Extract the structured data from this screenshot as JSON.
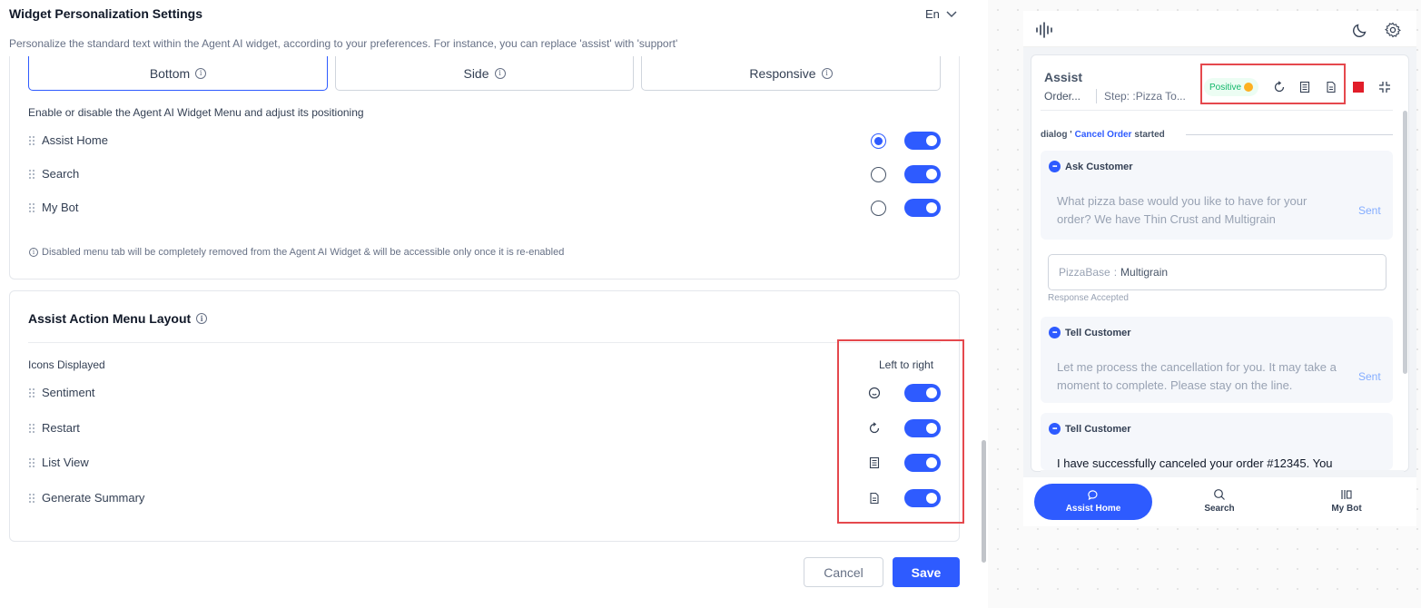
{
  "settings": {
    "title": "Widget Personalization Settings",
    "language": "En",
    "subtitle": "Personalize the standard text within the Agent AI widget, according to your preferences. For instance, you can replace 'assist' with 'support'",
    "position_tabs": [
      "Bottom",
      "Side",
      "Responsive"
    ],
    "active_position_tab": "Bottom",
    "menu_section_label": "Enable or disable the Agent AI Widget Menu and adjust its positioning",
    "menu_items": [
      {
        "label": "Assist Home",
        "default": true,
        "enabled": true
      },
      {
        "label": "Search",
        "default": false,
        "enabled": true
      },
      {
        "label": "My Bot",
        "default": false,
        "enabled": true
      }
    ],
    "menu_note": "Disabled menu tab will be completely removed from the Agent AI Widget & will be accessible only once it is re-enabled",
    "action_menu": {
      "title": "Assist Action Menu Layout",
      "icons_label": "Icons Displayed",
      "direction_label": "Left to right",
      "items": [
        {
          "label": "Sentiment",
          "icon": "smiley-icon",
          "enabled": true
        },
        {
          "label": "Restart",
          "icon": "restart-icon",
          "enabled": true
        },
        {
          "label": "List View",
          "icon": "list-view-icon",
          "enabled": true
        },
        {
          "label": "Generate Summary",
          "icon": "summary-doc-icon",
          "enabled": true
        }
      ]
    },
    "buttons": {
      "cancel": "Cancel",
      "save": "Save"
    }
  },
  "preview": {
    "assist_title": "Assist",
    "order_label": "Order...",
    "step_label": "Step: :Pizza To...",
    "sentiment_badge": "Positive",
    "dialog": {
      "prefix": "dialog '",
      "name": "Cancel Order",
      "suffix": "started"
    },
    "messages": [
      {
        "type": "Ask Customer",
        "text_line1": "What pizza base would you like to have for your",
        "text_line2": "order? We have Thin Crust and Multigrain",
        "status": "Sent"
      },
      {
        "type": "Tell Customer",
        "text_line1": "Let me process the cancellation for you. It may take a",
        "text_line2": "moment to complete. Please stay on the line.",
        "status": "Sent"
      },
      {
        "type": "Tell Customer",
        "text_line1": "I have successfully canceled your order #12345. You",
        "text_line2": "",
        "status": ""
      }
    ],
    "field": {
      "key": "PizzaBase",
      "sep": ":",
      "value": "Multigrain"
    },
    "field_note": "Response Accepted",
    "nav": [
      {
        "label": "Assist Home",
        "icon": "chat-bubble-icon",
        "active": true
      },
      {
        "label": "Search",
        "icon": "search-icon",
        "active": false
      },
      {
        "label": "My Bot",
        "icon": "bot-library-icon",
        "active": false
      }
    ]
  },
  "colors": {
    "accent": "#2e5bff",
    "highlight_box": "#e5484d",
    "positive": "#12b76a",
    "stop": "#e11d29"
  }
}
